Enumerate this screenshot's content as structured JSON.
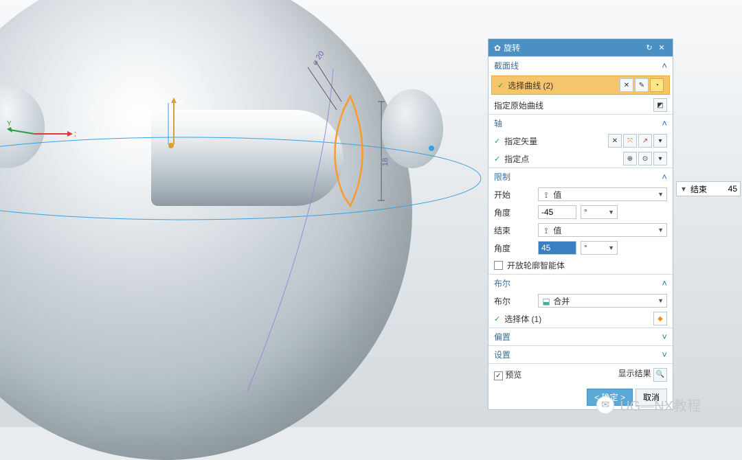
{
  "axis_labels": {
    "x": "X",
    "y": "Y"
  },
  "dimensions": {
    "d1": "⌀ 20",
    "d2": "18"
  },
  "panel": {
    "title": "旋转",
    "sections": {
      "section_curve": "截面线",
      "axis": "轴",
      "limits": "限制",
      "boolean": "布尔",
      "offset": "偏置",
      "settings": "设置"
    },
    "select_curve": "选择曲线 (2)",
    "orig_curve": "指定原始曲线",
    "specify_vector": "指定矢量",
    "specify_point": "指定点",
    "start_label": "开始",
    "start_value_mode": "值",
    "angle_label": "角度",
    "angle_start": "-45",
    "end_label": "结束",
    "end_value_mode": "值",
    "angle_end": "45",
    "unit": "°",
    "open_profile_smart": "开放轮廓智能体",
    "boolean_label": "布尔",
    "boolean_mode": "合并",
    "select_body": "选择体 (1)",
    "preview": "预览",
    "show_result": "显示结果",
    "ok": "< 确定 >",
    "cancel": "取消"
  },
  "float": {
    "end_label": "结束",
    "end_val": "45"
  },
  "watermark": "UG—NX教程"
}
